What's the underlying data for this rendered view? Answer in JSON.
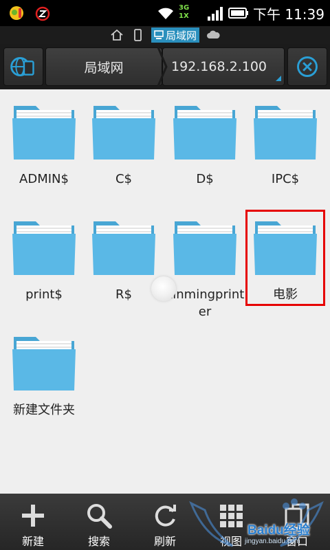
{
  "status_bar": {
    "network_type": "3G",
    "network_type2": "1X",
    "time": "下午 11:39"
  },
  "path_strip": {
    "current": "局域网"
  },
  "toolbar": {
    "crumb_lan": "局域网",
    "crumb_ip": "192.168.2.100"
  },
  "files": [
    {
      "name": "ADMIN$"
    },
    {
      "name": "C$"
    },
    {
      "name": "D$"
    },
    {
      "name": "IPC$"
    },
    {
      "name": "print$"
    },
    {
      "name": "R$"
    },
    {
      "name": "xinmingprinter"
    },
    {
      "name": "电影"
    },
    {
      "name": "新建文件夹"
    }
  ],
  "bottom_bar": {
    "new_label": "新建",
    "search_label": "搜索",
    "refresh_label": "刷新",
    "view_label": "视图",
    "window_label": "窗口"
  },
  "watermark": {
    "text": "Baidu经验",
    "sub": "jingyan.baidu.com"
  },
  "colors": {
    "folder": "#5ab8e6",
    "accent": "#2a9fd6",
    "highlight": "#e60000"
  }
}
